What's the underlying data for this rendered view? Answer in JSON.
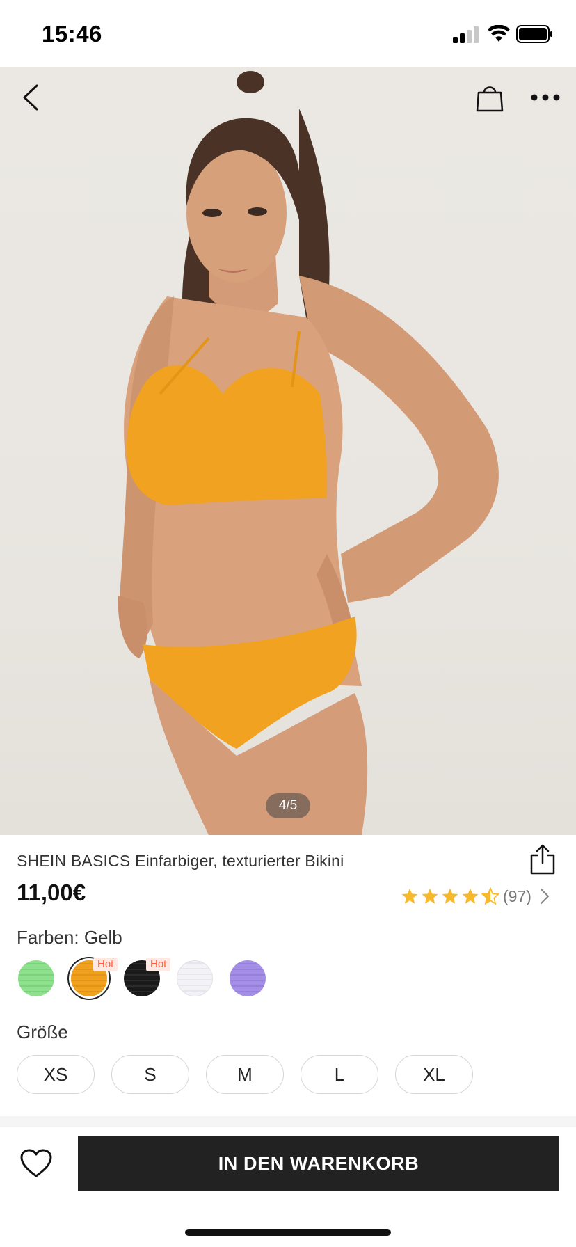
{
  "status_bar": {
    "time": "15:46"
  },
  "header": {
    "back_icon": "chevron-left-icon",
    "bag_icon": "shopping-bag-icon",
    "more_icon": "more-horizontal-icon"
  },
  "gallery": {
    "counter": "4/5",
    "current": 4,
    "total": 5
  },
  "product": {
    "title": "SHEIN BASICS Einfarbiger, texturierter Bikini",
    "price": "11,00€",
    "rating_value": 4.5,
    "rating_count": "(97)"
  },
  "colors": {
    "label": "Farben: Gelb",
    "options": [
      {
        "name": "green",
        "hex": "#8fe08e",
        "hot": ""
      },
      {
        "name": "yellow",
        "hex": "#f0a21f",
        "hot": "Hot",
        "selected": true
      },
      {
        "name": "black",
        "hex": "#1a1a1a",
        "hot": "Hot"
      },
      {
        "name": "white",
        "hex": "#f2f2f7",
        "hot": ""
      },
      {
        "name": "purple",
        "hex": "#a48ee6",
        "hot": ""
      }
    ]
  },
  "sizes": {
    "label": "Größe",
    "options": [
      "XS",
      "S",
      "M",
      "L",
      "XL"
    ]
  },
  "actions": {
    "add_to_cart": "IN DEN WARENKORB",
    "wishlist_icon": "heart-icon",
    "share_icon": "share-icon"
  },
  "colors_theme": {
    "accent": "#222222",
    "star": "#f6b92b",
    "hot": "#ff5a3c"
  }
}
